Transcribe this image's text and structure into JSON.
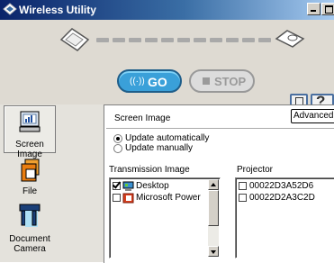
{
  "window": {
    "title": "Wireless Utility"
  },
  "controls": {
    "go_label": "GO",
    "go_signal": "((·))",
    "stop_label": "STOP"
  },
  "sidebar": {
    "items": [
      {
        "label": "Screen Image",
        "selected": true
      },
      {
        "label": "File",
        "selected": false
      },
      {
        "label": "Document Camera",
        "selected": false
      }
    ]
  },
  "main": {
    "section_title": "Screen Image",
    "advanced_label": "Advanced.",
    "update_auto": "Update automatically",
    "update_manual": "Update manually",
    "update_selected": "auto",
    "transmission_label": "Transmission Image",
    "projector_label": "Projector",
    "transmission_items": [
      {
        "label": "Desktop",
        "checked": true,
        "icon": "desktop-icon"
      },
      {
        "label": "Microsoft Power",
        "checked": false,
        "icon": "powerpoint-icon"
      }
    ],
    "projector_items": [
      {
        "label": "00022D3A52D6",
        "checked": false
      },
      {
        "label": "00022D2A3C2D",
        "checked": false
      }
    ]
  },
  "colors": {
    "title_bar": "#0a246a",
    "go_button": "#3aa0d9",
    "accent": "#4a6fa0"
  }
}
